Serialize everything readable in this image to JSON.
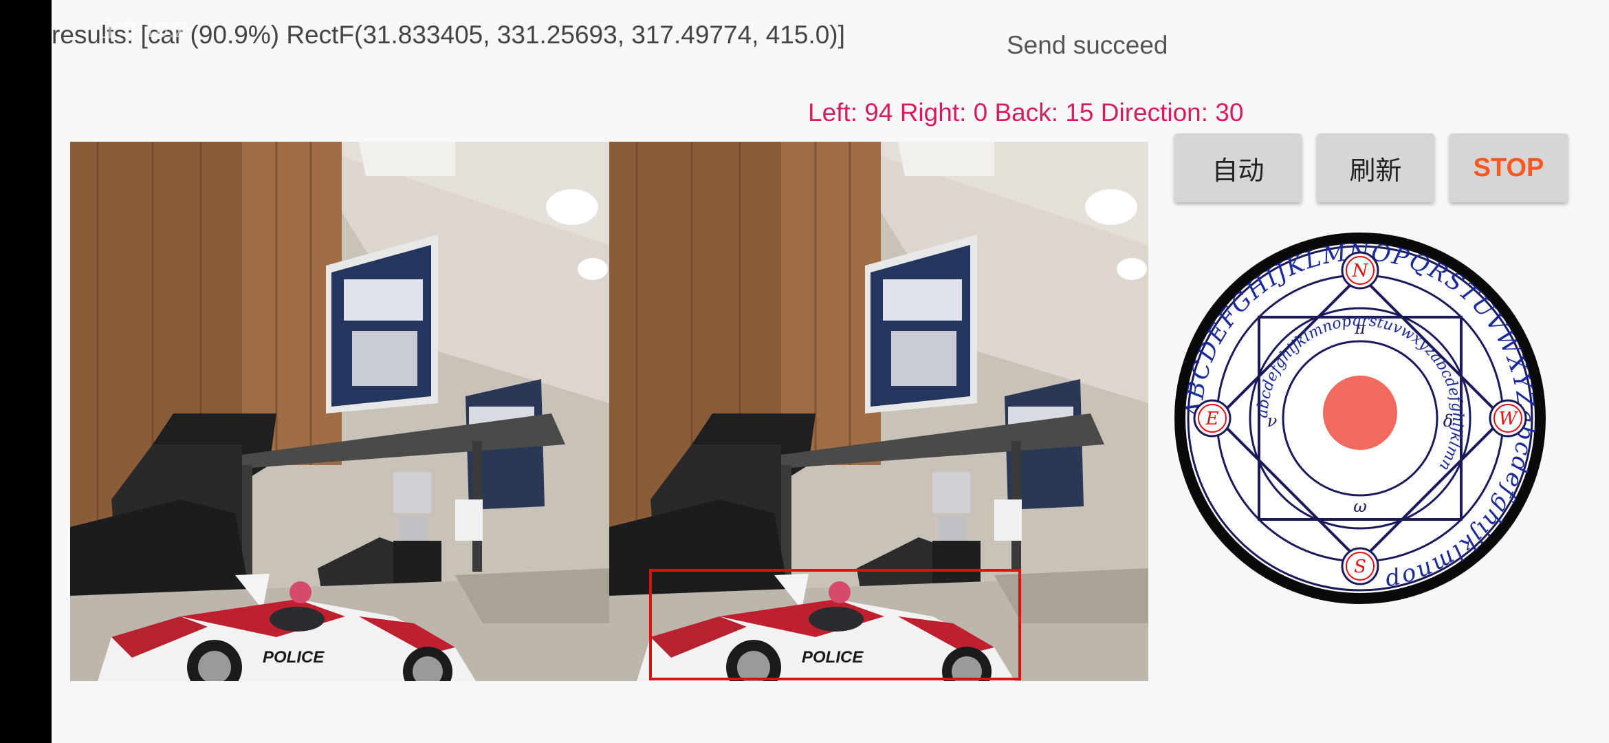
{
  "overlay": {
    "status_time": "上午10:2"
  },
  "detection": {
    "results_text": "results: [car (90.9%) RectF(31.833405, 331.25693, 317.49774, 415.0)]"
  },
  "send": {
    "status": "Send succeed"
  },
  "motors": {
    "readout": "Left: 94 Right: 0 Back: 15 Direction: 30"
  },
  "controls": {
    "auto_label": "自动",
    "refresh_label": "刷新",
    "stop_label": "STOP"
  },
  "car_decal": {
    "text": "POLICE"
  },
  "joystick": {
    "seal_letters": [
      "N",
      "E",
      "W",
      "S"
    ],
    "ring_glyphs": [
      "π",
      "δ",
      "ω",
      "ν"
    ]
  },
  "colors": {
    "accent_pink": "#d81b60",
    "stop_orange": "#ff5722",
    "button_bg": "#d6d6d6",
    "knob": "#f06a5d",
    "detect_box": "#e01010"
  }
}
